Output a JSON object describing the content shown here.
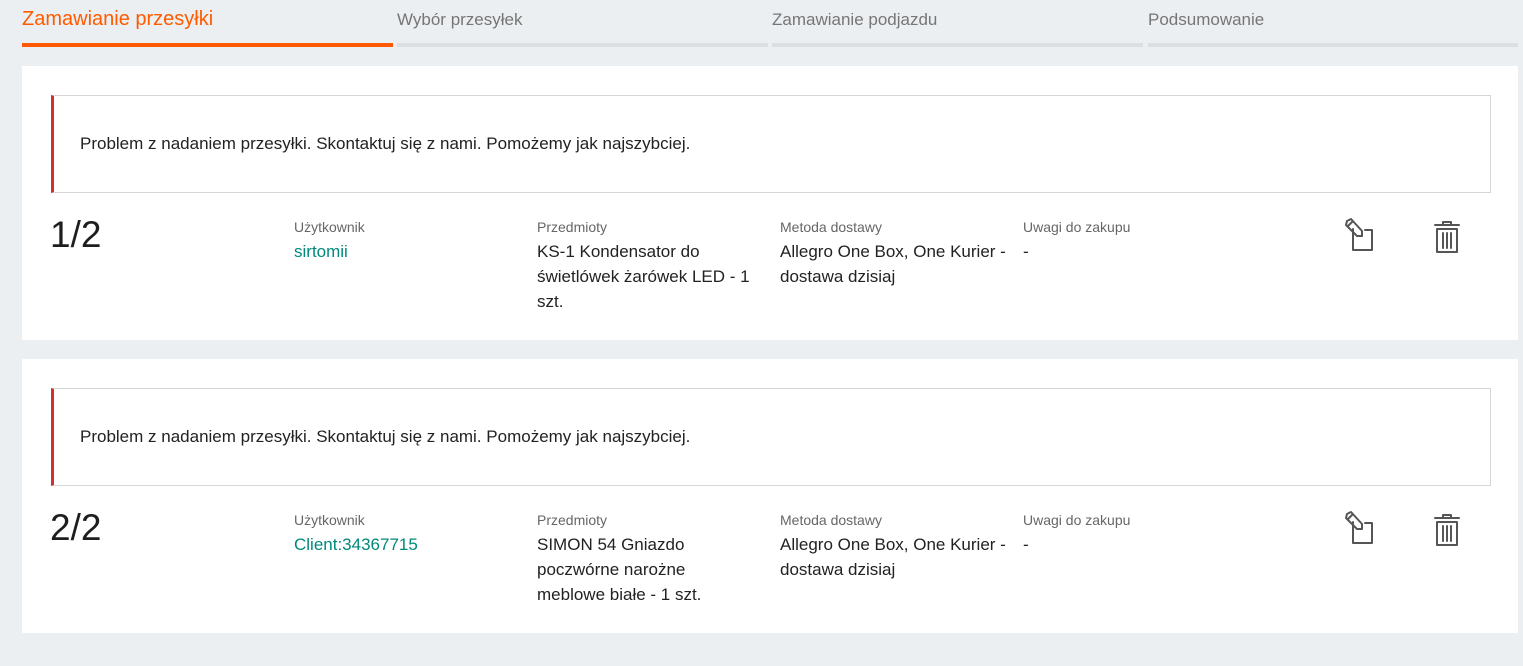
{
  "stepper": {
    "steps": [
      {
        "label": "Zamawianie przesyłki",
        "active": true
      },
      {
        "label": "Wybór przesyłek",
        "active": false
      },
      {
        "label": "Zamawianie podjazdu",
        "active": false
      },
      {
        "label": "Podsumowanie",
        "active": false
      }
    ]
  },
  "colors": {
    "accent": "#ff5a00",
    "error": "#d32f2f",
    "link": "#00897b"
  },
  "shipments": [
    {
      "alert": "Problem z nadaniem przesyłki. Skontaktuj się z nami. Pomożemy jak najszybciej.",
      "counter": "1/2",
      "user_label": "Użytkownik",
      "user": "sirtomii",
      "items_label": "Przedmioty",
      "items": "KS-1 Kondensator do świetlówek żarówek LED - 1 szt.",
      "delivery_label": "Metoda dostawy",
      "delivery": "Allegro One Box, One Kurier - dostawa dzisiaj",
      "notes_label": "Uwagi do zakupu",
      "notes": "-",
      "edit_icon": "edit-document-icon",
      "delete_icon": "trash-icon"
    },
    {
      "alert": "Problem z nadaniem przesyłki. Skontaktuj się z nami. Pomożemy jak najszybciej.",
      "counter": "2/2",
      "user_label": "Użytkownik",
      "user": "Client:34367715",
      "items_label": "Przedmioty",
      "items": "SIMON 54 Gniazdo poczwórne narożne meblowe białe - 1 szt.",
      "delivery_label": "Metoda dostawy",
      "delivery": "Allegro One Box, One Kurier - dostawa dzisiaj",
      "notes_label": "Uwagi do zakupu",
      "notes": "-",
      "edit_icon": "edit-document-icon",
      "delete_icon": "trash-icon"
    }
  ]
}
